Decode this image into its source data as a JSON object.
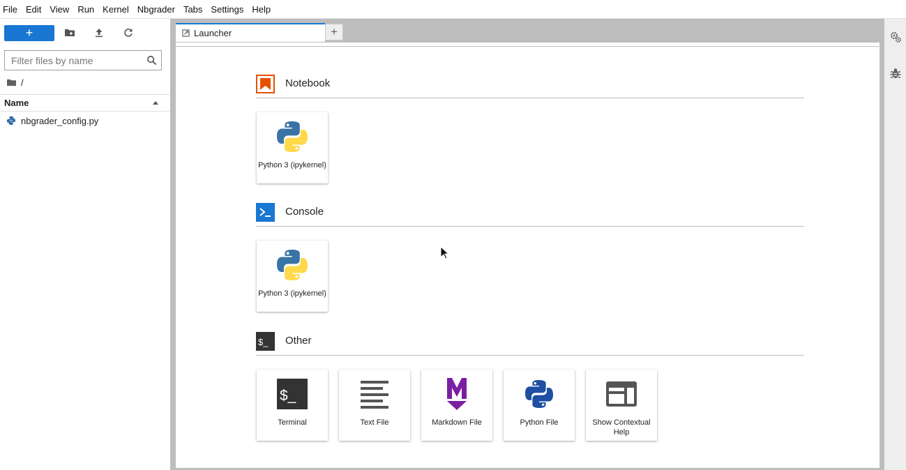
{
  "menu": [
    "File",
    "Edit",
    "View",
    "Run",
    "Kernel",
    "Nbgrader",
    "Tabs",
    "Settings",
    "Help"
  ],
  "file_browser": {
    "new_label": "+",
    "filter_placeholder": "Filter files by name",
    "breadcrumb": "/",
    "column_name": "Name",
    "files": [
      {
        "name": "nbgrader_config.py",
        "icon": "python-file-icon"
      }
    ]
  },
  "tabs": [
    {
      "label": "Launcher",
      "icon": "launcher-icon"
    }
  ],
  "add_tab_label": "+",
  "launcher": {
    "sections": [
      {
        "title": "Notebook",
        "icon": "notebook-icon",
        "color": "#e65100",
        "items": [
          {
            "label": "Python 3 (ipykernel)",
            "icon": "python-logo-icon"
          }
        ]
      },
      {
        "title": "Console",
        "icon": "console-icon",
        "color": "#1976d2",
        "items": [
          {
            "label": "Python 3 (ipykernel)",
            "icon": "python-logo-icon"
          }
        ]
      },
      {
        "title": "Other",
        "icon": "terminal-section-icon",
        "color": "#333333",
        "items": [
          {
            "label": "Terminal",
            "icon": "terminal-icon"
          },
          {
            "label": "Text File",
            "icon": "text-file-icon"
          },
          {
            "label": "Markdown File",
            "icon": "markdown-icon"
          },
          {
            "label": "Python File",
            "icon": "python-file-icon"
          },
          {
            "label": "Show Contextual Help",
            "icon": "contextual-help-icon"
          }
        ]
      }
    ]
  },
  "colors": {
    "accent": "#1976d2",
    "markdown": "#7b1fa2",
    "python_blue": "#2f67a8",
    "python_yellow": "#ffd94a"
  }
}
